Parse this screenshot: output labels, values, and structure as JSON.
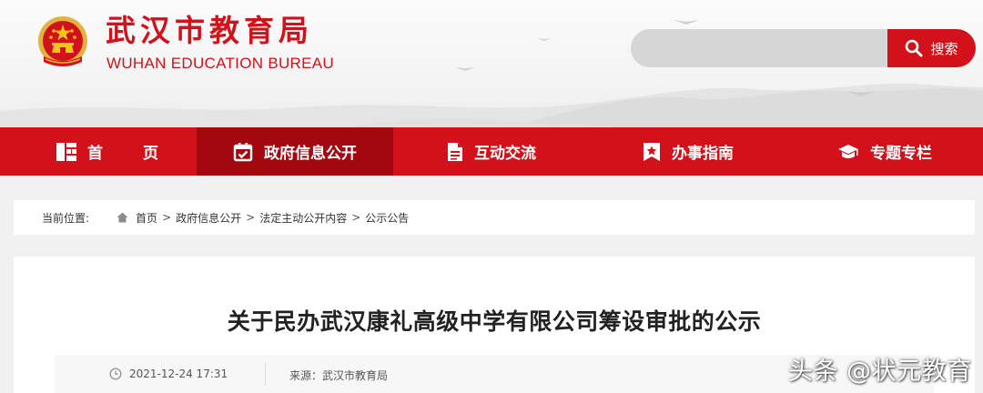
{
  "header": {
    "title_cn": "武汉市教育局",
    "title_en": "WUHAN EDUCATION BUREAU",
    "emblem_icon": "national-emblem-icon"
  },
  "search": {
    "value": "",
    "placeholder": "",
    "button_label": "搜索",
    "icon": "search-icon"
  },
  "nav": {
    "items": [
      {
        "label": "首页",
        "icon": "home-grid-icon"
      },
      {
        "label": "政府信息公开",
        "icon": "calendar-check-icon",
        "active": true
      },
      {
        "label": "互动交流",
        "icon": "document-icon"
      },
      {
        "label": "办事指南",
        "icon": "star-bookmark-icon"
      },
      {
        "label": "专题专栏",
        "icon": "graduation-cap-icon"
      }
    ]
  },
  "breadcrumb": {
    "prefix": "当前位置:",
    "items": [
      "首页",
      "政府信息公开",
      "法定主动公开内容",
      "公示公告"
    ],
    "separator": ">"
  },
  "article": {
    "title": "关于民办武汉康礼高级中学有限公司筹设审批的公示",
    "time": "2021-12-24 17:31",
    "source": "来源：武汉市教育局"
  },
  "watermark": "头条 @状元教育",
  "colors": {
    "brand_red": "#d2111b",
    "nav_active": "#a3080f",
    "page_bg": "#f1f1f1"
  }
}
